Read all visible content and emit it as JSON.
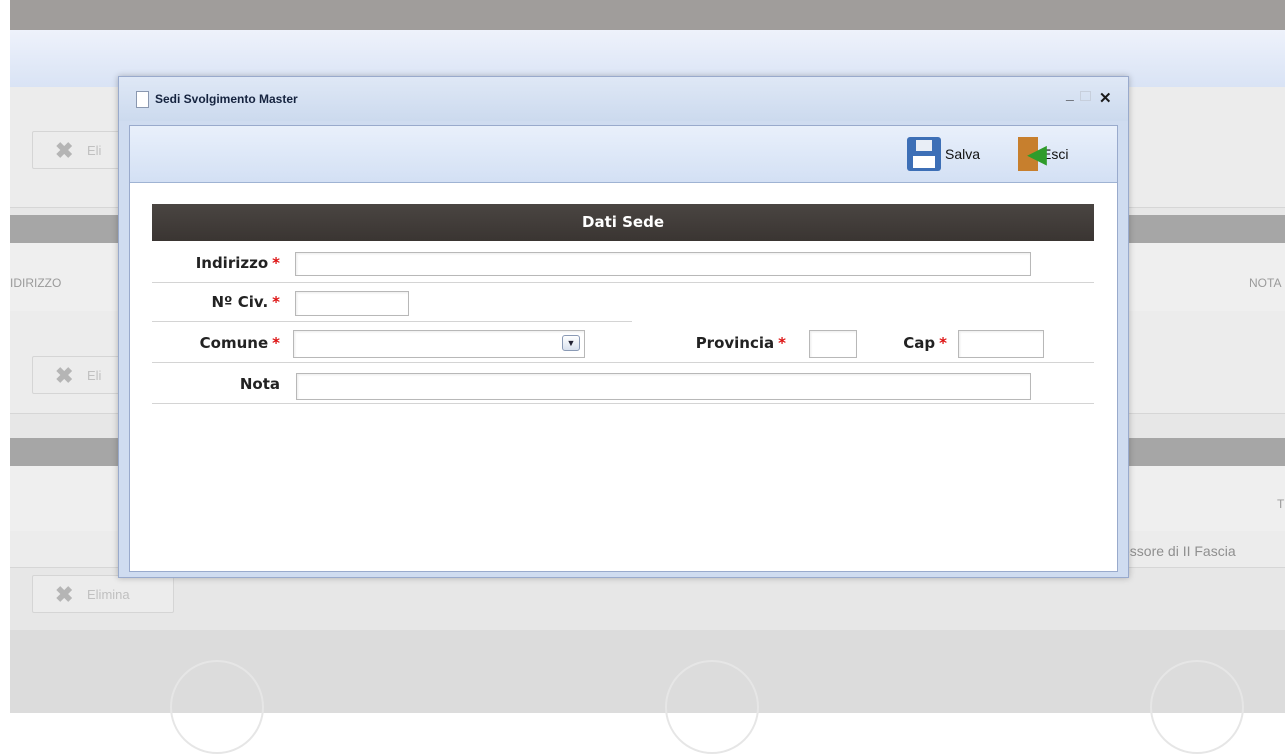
{
  "background": {
    "delete_button_label_partial": "Eli",
    "delete_button_label": "Elimina",
    "column_indirizzo": "IDIRIZZO",
    "column_nota": "NOTA",
    "column_t": "T",
    "row_text": "essore di II Fascia"
  },
  "window": {
    "title": "Sedi Svolgimento Master",
    "controls": {
      "minimize": "_",
      "close": "✕"
    }
  },
  "toolbar": {
    "save_label": "Salva",
    "exit_label": "Esci"
  },
  "form": {
    "section_title": "Dati Sede",
    "required_mark": "*",
    "fields": {
      "indirizzo": {
        "label": "Indirizzo",
        "value": ""
      },
      "civico": {
        "label": "Nº Civ.",
        "value": ""
      },
      "comune": {
        "label": "Comune",
        "value": ""
      },
      "provincia": {
        "label": "Provincia",
        "value": ""
      },
      "cap": {
        "label": "Cap",
        "value": ""
      },
      "nota": {
        "label": "Nota",
        "value": ""
      }
    }
  },
  "colors": {
    "section_header": "#3f3a37",
    "required": "#dd1111",
    "window_border": "#99aacc"
  },
  "icons": [
    "document-icon",
    "save-floppy-icon",
    "exit-door-icon",
    "select-chevron-icon",
    "delete-x-icon"
  ]
}
